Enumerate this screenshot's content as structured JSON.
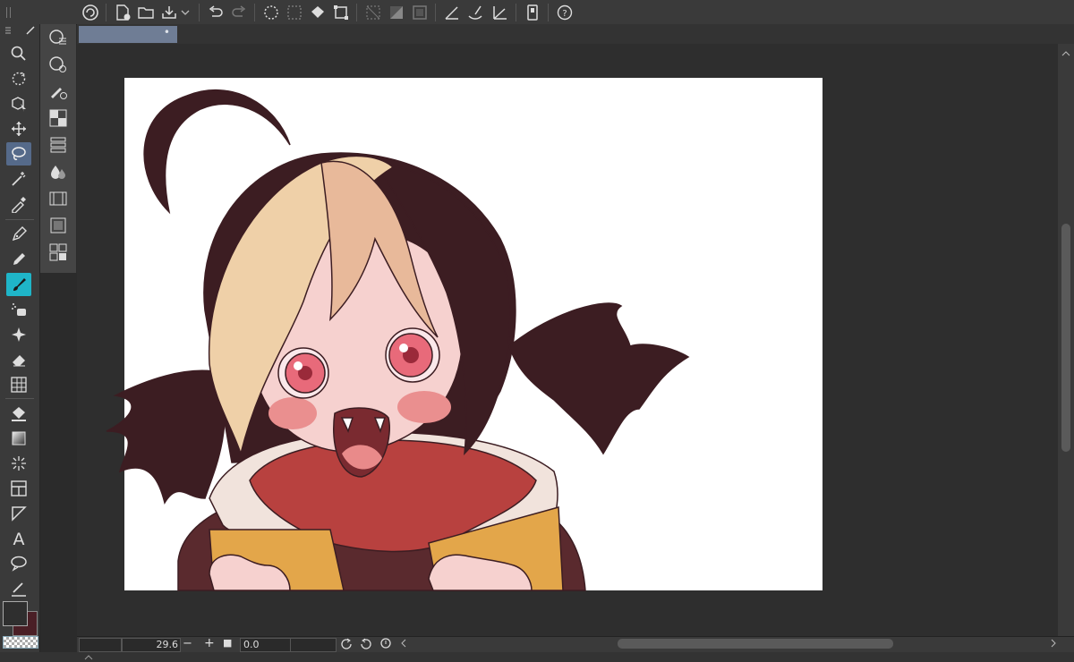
{
  "app": {
    "accent": "#556a8a",
    "tool_highlight": "#1fb5c8"
  },
  "toolbar": {
    "icons": [
      "app-logo-icon",
      "new-file-icon",
      "open-folder-icon",
      "save-icon",
      "dropdown-icon",
      "undo-icon",
      "redo-icon",
      "lasso-select-icon",
      "select-all-icon",
      "fill-icon",
      "transform-icon",
      "clear-icon",
      "fill-layer-icon",
      "border-icon",
      "ruler-icon",
      "brush-ruler-icon",
      "perspective-icon",
      "device-icon",
      "help-icon"
    ]
  },
  "tools": {
    "items": [
      "zoom-icon",
      "rotate-view-icon",
      "object-select-icon",
      "move-icon",
      "lasso-icon",
      "magic-wand-icon",
      "eyedropper-icon",
      "pen-icon",
      "pencil-icon",
      "brush-icon",
      "airbrush-icon",
      "decoration-icon",
      "eraser-icon",
      "blend-icon",
      "fill-bucket-icon",
      "gradient-icon",
      "figure-icon",
      "frame-icon",
      "ruler-icon",
      "text-icon",
      "balloon-icon",
      "correct-line-icon"
    ],
    "active": "lasso-icon",
    "highlighted": "brush-icon"
  },
  "colors": {
    "main": "#2f2f2f",
    "sub": "#4a1f26"
  },
  "document": {
    "tab_dot": "•"
  },
  "status": {
    "zoom_value": "29.6",
    "zoom_out_label": "−",
    "zoom_in_label": "+",
    "stop_label": "■",
    "rotation_value": "0.0"
  },
  "illustration": {
    "hair_dark": "#3c1d22",
    "hair_light": "#e8b99a",
    "hair_blond": "#efd0a8",
    "skin": "#f6d1cf",
    "blush": "#ea8f8f",
    "eye": "#e86a7a",
    "hood": "#b8413f",
    "jacket_yellow": "#e3a64a",
    "knit": "#f1e3dc"
  }
}
